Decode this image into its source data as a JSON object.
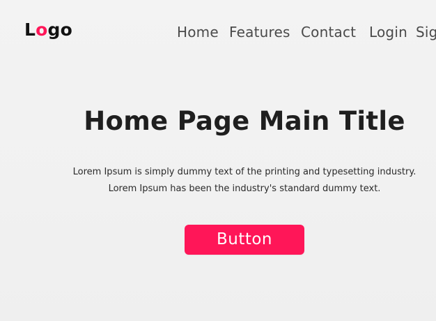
{
  "header": {
    "logo": {
      "prefix": "L",
      "accent": "o",
      "suffix": "go",
      "accent_color": "#ff1658"
    },
    "nav": [
      "Home",
      "Features",
      "Contact",
      "Login",
      "Sig"
    ]
  },
  "hero": {
    "title": "Home Page Main Title",
    "description": [
      "Lorem Ipsum is simply dummy text of the printing and typesetting industry.",
      "Lorem Ipsum has been the industry's standard dummy text."
    ],
    "button_label": "Button",
    "button_color": "#ff1658"
  }
}
